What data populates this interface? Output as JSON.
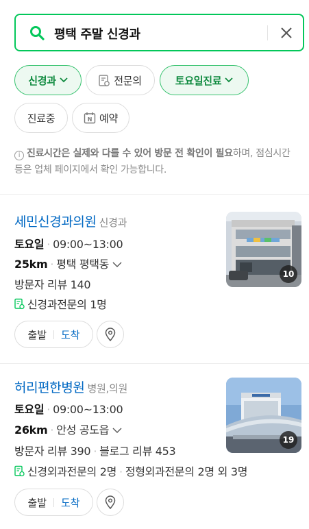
{
  "search": {
    "query": "평택 주말 신경과"
  },
  "filters": [
    {
      "label": "신경과",
      "active": true,
      "dropdown": true
    },
    {
      "label": "전문의",
      "active": false,
      "icon": "doctor-doc-icon"
    },
    {
      "label": "토요일진료",
      "active": true,
      "dropdown": true
    },
    {
      "label": "진료중",
      "active": false
    },
    {
      "label": "예약",
      "active": false,
      "icon": "naver-booking-icon"
    }
  ],
  "notice": {
    "strong": "진료시간은 실제와 다를 수 있어 방문 전 확인이 필요",
    "rest": "하며, 점심시간 등은 업체 페이지에서 확인 가능합니다."
  },
  "results": [
    {
      "name": "세민신경과의원",
      "category": "신경과",
      "day": "토요일",
      "hours": "09:00~13:00",
      "distance": "25km",
      "area": "평택 평택동",
      "reviews": [
        "방문자 리뷰 140"
      ],
      "specialists": [
        "신경과전문의 1명"
      ],
      "photo_count": "10",
      "depart_label": "출발",
      "arrive_label": "도착"
    },
    {
      "name": "허리편한병원",
      "category": "병원,의원",
      "day": "토요일",
      "hours": "09:00~13:00",
      "distance": "26km",
      "area": "안성 공도읍",
      "reviews": [
        "방문자 리뷰 390",
        "블로그 리뷰 453"
      ],
      "specialists": [
        "신경외과전문의 2명",
        "정형외과전문의 2명 외 3명"
      ],
      "photo_count": "19",
      "depart_label": "출발",
      "arrive_label": "도착"
    }
  ],
  "colors": {
    "accent": "#03c75a",
    "link": "#0068c3",
    "chip_active_bg": "#edf9f1"
  }
}
